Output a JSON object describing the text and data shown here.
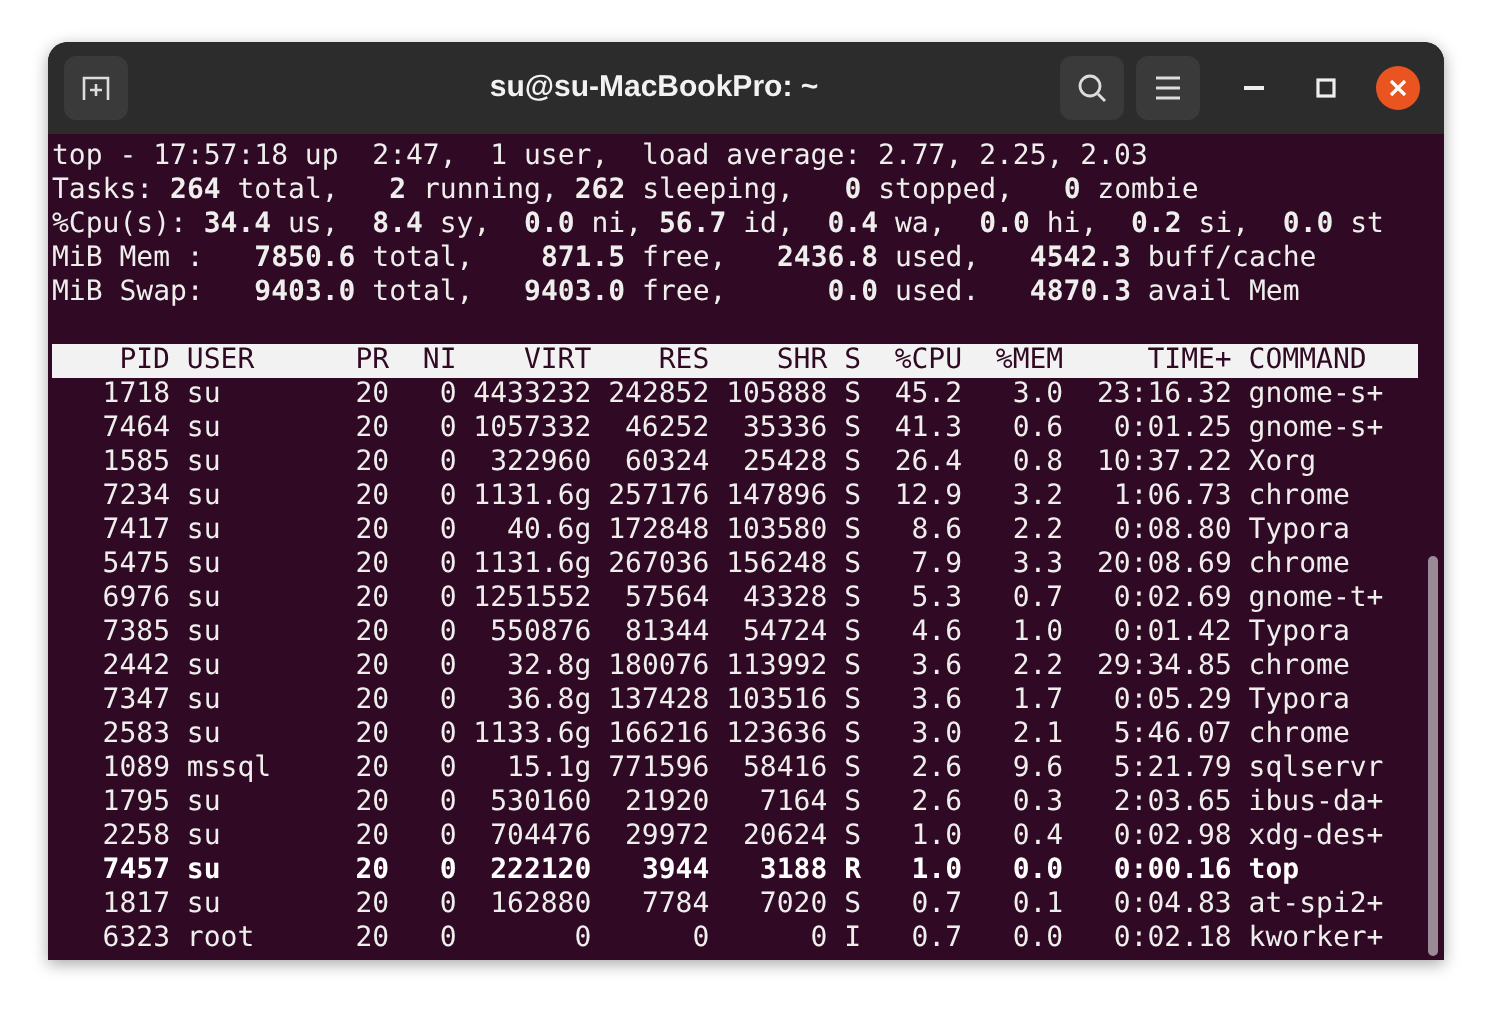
{
  "window": {
    "title": "su@su-MacBookPro: ~"
  },
  "summary": [
    "top - 17:57:18 up  2:47,  1 user,  load average: 2.77, 2.25, 2.03",
    "Tasks: **264** total,   **2** running, **262** sleeping,   **0** stopped,   **0** zombie",
    "%Cpu(s): **34.4** us,  **8.4** sy,  **0.0** ni, **56.7** id,  **0.4** wa,  **0.0** hi,  **0.2** si,  **0.0** st",
    "MiB Mem :   **7850.6** total,    **871.5** free,   **2436.8** used,   **4542.3** buff/cache",
    "MiB Swap:   **9403.0** total,   **9403.0** free,      **0.0** used.   **4870.3** avail Mem"
  ],
  "table": {
    "columns": [
      "PID",
      "USER",
      "PR",
      "NI",
      "VIRT",
      "RES",
      "SHR",
      "S",
      "%CPU",
      "%MEM",
      "TIME+",
      "COMMAND"
    ],
    "rows": [
      {
        "running": false,
        "cells": [
          "1718",
          "su",
          "20",
          "0",
          "4433232",
          "242852",
          "105888",
          "S",
          "45.2",
          "3.0",
          "23:16.32",
          "gnome-s+"
        ]
      },
      {
        "running": false,
        "cells": [
          "7464",
          "su",
          "20",
          "0",
          "1057332",
          "46252",
          "35336",
          "S",
          "41.3",
          "0.6",
          "0:01.25",
          "gnome-s+"
        ]
      },
      {
        "running": false,
        "cells": [
          "1585",
          "su",
          "20",
          "0",
          "322960",
          "60324",
          "25428",
          "S",
          "26.4",
          "0.8",
          "10:37.22",
          "Xorg"
        ]
      },
      {
        "running": false,
        "cells": [
          "7234",
          "su",
          "20",
          "0",
          "1131.6g",
          "257176",
          "147896",
          "S",
          "12.9",
          "3.2",
          "1:06.73",
          "chrome"
        ]
      },
      {
        "running": false,
        "cells": [
          "7417",
          "su",
          "20",
          "0",
          "40.6g",
          "172848",
          "103580",
          "S",
          "8.6",
          "2.2",
          "0:08.80",
          "Typora"
        ]
      },
      {
        "running": false,
        "cells": [
          "5475",
          "su",
          "20",
          "0",
          "1131.6g",
          "267036",
          "156248",
          "S",
          "7.9",
          "3.3",
          "20:08.69",
          "chrome"
        ]
      },
      {
        "running": false,
        "cells": [
          "6976",
          "su",
          "20",
          "0",
          "1251552",
          "57564",
          "43328",
          "S",
          "5.3",
          "0.7",
          "0:02.69",
          "gnome-t+"
        ]
      },
      {
        "running": false,
        "cells": [
          "7385",
          "su",
          "20",
          "0",
          "550876",
          "81344",
          "54724",
          "S",
          "4.6",
          "1.0",
          "0:01.42",
          "Typora"
        ]
      },
      {
        "running": false,
        "cells": [
          "2442",
          "su",
          "20",
          "0",
          "32.8g",
          "180076",
          "113992",
          "S",
          "3.6",
          "2.2",
          "29:34.85",
          "chrome"
        ]
      },
      {
        "running": false,
        "cells": [
          "7347",
          "su",
          "20",
          "0",
          "36.8g",
          "137428",
          "103516",
          "S",
          "3.6",
          "1.7",
          "0:05.29",
          "Typora"
        ]
      },
      {
        "running": false,
        "cells": [
          "2583",
          "su",
          "20",
          "0",
          "1133.6g",
          "166216",
          "123636",
          "S",
          "3.0",
          "2.1",
          "5:46.07",
          "chrome"
        ]
      },
      {
        "running": false,
        "cells": [
          "1089",
          "mssql",
          "20",
          "0",
          "15.1g",
          "771596",
          "58416",
          "S",
          "2.6",
          "9.6",
          "5:21.79",
          "sqlservr"
        ]
      },
      {
        "running": false,
        "cells": [
          "1795",
          "su",
          "20",
          "0",
          "530160",
          "21920",
          "7164",
          "S",
          "2.6",
          "0.3",
          "2:03.65",
          "ibus-da+"
        ]
      },
      {
        "running": false,
        "cells": [
          "2258",
          "su",
          "20",
          "0",
          "704476",
          "29972",
          "20624",
          "S",
          "1.0",
          "0.4",
          "0:02.98",
          "xdg-des+"
        ]
      },
      {
        "running": true,
        "cells": [
          "7457",
          "su",
          "20",
          "0",
          "222120",
          "3944",
          "3188",
          "R",
          "1.0",
          "0.0",
          "0:00.16",
          "top"
        ]
      },
      {
        "running": false,
        "cells": [
          "1817",
          "su",
          "20",
          "0",
          "162880",
          "7784",
          "7020",
          "S",
          "0.7",
          "0.1",
          "0:04.83",
          "at-spi2+"
        ]
      },
      {
        "running": false,
        "cells": [
          "6323",
          "root",
          "20",
          "0",
          "0",
          "0",
          "0",
          "I",
          "0.7",
          "0.0",
          "0:02.18",
          "kworker+"
        ]
      }
    ]
  }
}
